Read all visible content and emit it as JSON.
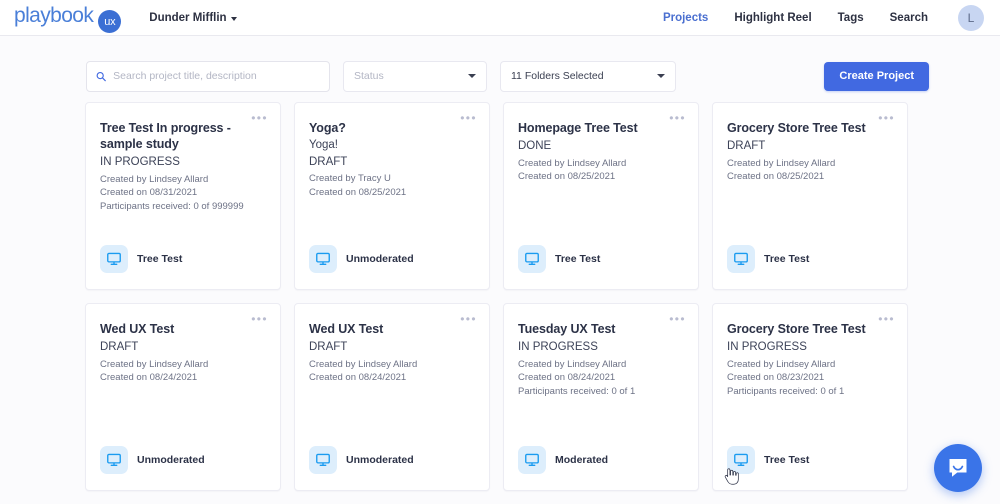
{
  "brand": {
    "logo_text": "playbook",
    "logo_badge": "ux",
    "logo_color": "#4a7fd8",
    "accent_color": "#4169e1"
  },
  "topnav": {
    "org_selector": "Dunder Mifflin",
    "links": [
      {
        "label": "Projects",
        "active": true
      },
      {
        "label": "Highlight Reel",
        "active": false
      },
      {
        "label": "Tags",
        "active": false
      },
      {
        "label": "Search",
        "active": false
      }
    ],
    "avatar_initial": "L"
  },
  "filters": {
    "search_placeholder": "Search project title, description",
    "search_value": "",
    "search_icon": "search-icon",
    "status_label": "Status",
    "folders_label": "11 Folders Selected",
    "create_button": "Create Project"
  },
  "cards": [
    {
      "title": "Tree Test In progress - sample study",
      "subtitle": "",
      "status": "IN PROGRESS",
      "created_by": "Created by Lindsey Allard",
      "created_on": "Created on 08/31/2021",
      "participants": "Participants received: 0 of 999999",
      "type": "Tree Test",
      "menu": "•••"
    },
    {
      "title": "Yoga?",
      "subtitle": "Yoga!",
      "status": "DRAFT",
      "created_by": "Created by Tracy U",
      "created_on": "Created on 08/25/2021",
      "participants": "",
      "type": "Unmoderated",
      "menu": "•••"
    },
    {
      "title": "Homepage Tree Test",
      "subtitle": "",
      "status": "DONE",
      "created_by": "Created by Lindsey Allard",
      "created_on": "Created on 08/25/2021",
      "participants": "",
      "type": "Tree Test",
      "menu": "•••"
    },
    {
      "title": "Grocery Store Tree Test",
      "subtitle": "",
      "status": "DRAFT",
      "created_by": "Created by Lindsey Allard",
      "created_on": "Created on 08/25/2021",
      "participants": "",
      "type": "Tree Test",
      "menu": "•••"
    },
    {
      "title": "Wed UX Test",
      "subtitle": "",
      "status": "DRAFT",
      "created_by": "Created by Lindsey Allard",
      "created_on": "Created on 08/24/2021",
      "participants": "",
      "type": "Unmoderated",
      "menu": "•••"
    },
    {
      "title": "Wed UX Test",
      "subtitle": "",
      "status": "DRAFT",
      "created_by": "Created by Lindsey Allard",
      "created_on": "Created on 08/24/2021",
      "participants": "",
      "type": "Unmoderated",
      "menu": "•••"
    },
    {
      "title": "Tuesday UX Test",
      "subtitle": "",
      "status": "IN PROGRESS",
      "created_by": "Created by Lindsey Allard",
      "created_on": "Created on 08/24/2021",
      "participants": "Participants received: 0 of 1",
      "type": "Moderated",
      "menu": "•••"
    },
    {
      "title": "Grocery Store Tree Test",
      "subtitle": "",
      "status": "IN PROGRESS",
      "created_by": "Created by Lindsey Allard",
      "created_on": "Created on 08/23/2021",
      "participants": "Participants received: 0 of 1",
      "type": "Tree Test",
      "menu": "•••"
    }
  ],
  "messenger": {
    "icon": "chat-bubble-icon"
  }
}
